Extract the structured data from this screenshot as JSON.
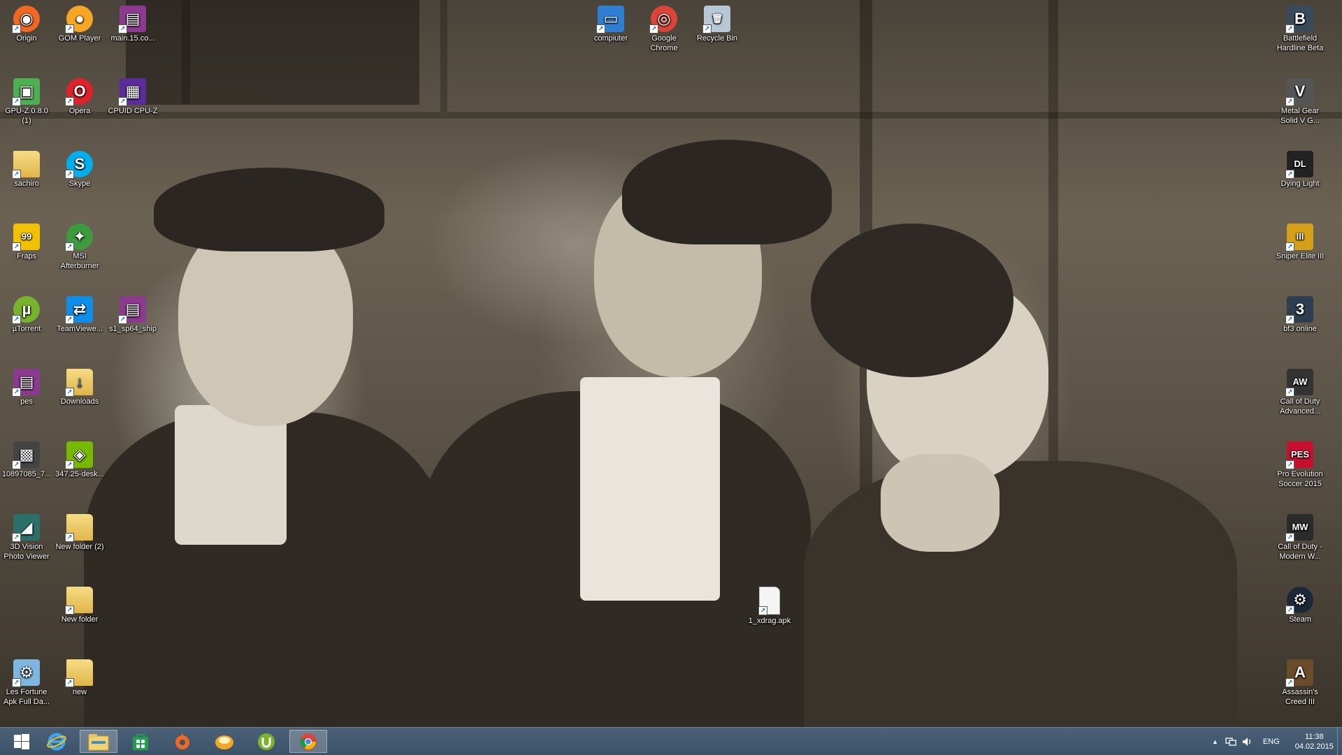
{
  "desktop": {
    "icons_left": [
      {
        "label": "Origin",
        "icon": "origin-icon",
        "color": "#f26722"
      },
      {
        "label": "GOM Player",
        "icon": "gom-player-icon",
        "color": "#f5a623"
      },
      {
        "label": "main.15.co...",
        "icon": "winrar-archive-icon",
        "color": "#8b3a8f"
      },
      {
        "label": "GPU-Z.0.8.0 (1)",
        "icon": "gpu-z-icon",
        "color": "#4caf50"
      },
      {
        "label": "Opera",
        "icon": "opera-icon",
        "color": "#e0202b"
      },
      {
        "label": "CPUID CPU-Z",
        "icon": "cpu-z-icon",
        "color": "#5b2c9a"
      },
      {
        "label": "sachiro",
        "icon": "folder-icon",
        "color": "#e8c25a"
      },
      {
        "label": "Skype",
        "icon": "skype-icon",
        "color": "#00aff0"
      },
      {
        "label": "Fraps",
        "icon": "fraps-icon",
        "color": "#f2c200"
      },
      {
        "label": "MSI Afterburner",
        "icon": "msi-afterburner-icon",
        "color": "#3c9b3c"
      },
      {
        "label": "µTorrent",
        "icon": "utorrent-icon",
        "color": "#78b42b"
      },
      {
        "label": "TeamViewe...",
        "icon": "teamviewer-icon",
        "color": "#0e8ee9"
      },
      {
        "label": "s1_sp64_ship",
        "icon": "winrar-archive-icon",
        "color": "#8b3a8f"
      },
      {
        "label": "pes",
        "icon": "winrar-archive-icon",
        "color": "#8b3a8f"
      },
      {
        "label": "Downloads",
        "icon": "downloads-folder-icon",
        "color": "#e8c25a"
      },
      {
        "label": "10897085_7...",
        "icon": "image-file-icon",
        "color": "#444444"
      },
      {
        "label": "347.25-desk...",
        "icon": "nvidia-installer-icon",
        "color": "#76b900"
      },
      {
        "label": "3D Vision Photo Viewer",
        "icon": "3d-vision-icon",
        "color": "#2a6f6a"
      },
      {
        "label": "New folder (2)",
        "icon": "folder-icon",
        "color": "#e8c25a"
      },
      {
        "label": "New folder",
        "icon": "folder-icon",
        "color": "#e8c25a"
      },
      {
        "label": "Les Fortune Apk Full Da...",
        "icon": "apk-file-icon",
        "color": "#7fb6e0"
      },
      {
        "label": "new",
        "icon": "folder-icon",
        "color": "#e8c25a"
      }
    ],
    "icons_top": [
      {
        "label": "compiuter",
        "icon": "computer-icon",
        "color": "#2d7fd3"
      },
      {
        "label": "Google Chrome",
        "icon": "chrome-icon",
        "color": "#db4437"
      },
      {
        "label": "Recycle Bin",
        "icon": "recycle-bin-icon",
        "color": "#b8c7d6"
      }
    ],
    "icons_middle": [
      {
        "label": "1_xdrag.apk",
        "icon": "file-icon",
        "color": "#f2f2f2"
      }
    ],
    "icons_right": [
      {
        "label": "Battlefield Hardline Beta",
        "icon": "battlefield-icon",
        "color": "#3a4a5a"
      },
      {
        "label": "Metal Gear Solid V G...",
        "icon": "metal-gear-icon",
        "color": "#555555"
      },
      {
        "label": "Dying Light",
        "icon": "dying-light-icon",
        "color": "#222222"
      },
      {
        "label": "Sniper Elite III",
        "icon": "sniper-elite-icon",
        "color": "#d4a017"
      },
      {
        "label": "bf3 online",
        "icon": "bf3-icon",
        "color": "#2c3e50"
      },
      {
        "label": "Call of Duty Advanced...",
        "icon": "cod-aw-icon",
        "color": "#333333"
      },
      {
        "label": "Pro Evolution Soccer 2015",
        "icon": "pes-icon",
        "color": "#c8102e"
      },
      {
        "label": "Call of Duty - Modern W...",
        "icon": "cod-mw-icon",
        "color": "#2b2b2b"
      },
      {
        "label": "Steam",
        "icon": "steam-icon",
        "color": "#1b2838"
      },
      {
        "label": "Assassin's Creed III",
        "icon": "assassins-creed-icon",
        "color": "#6b4c2a"
      }
    ]
  },
  "taskbar": {
    "pinned": [
      {
        "name": "start-button",
        "icon": "windows-logo-icon"
      },
      {
        "name": "internet-explorer",
        "icon": "internet-explorer-icon"
      },
      {
        "name": "file-explorer",
        "icon": "file-explorer-icon",
        "active": true
      },
      {
        "name": "windows-store",
        "icon": "store-icon"
      },
      {
        "name": "origin",
        "icon": "origin-icon"
      },
      {
        "name": "gom-player",
        "icon": "gom-player-icon"
      },
      {
        "name": "utorrent",
        "icon": "utorrent-icon"
      },
      {
        "name": "google-chrome",
        "icon": "chrome-icon",
        "active": true
      }
    ],
    "tray": {
      "language": "ENG",
      "time": "11:38",
      "date": "04.02.2015"
    }
  }
}
